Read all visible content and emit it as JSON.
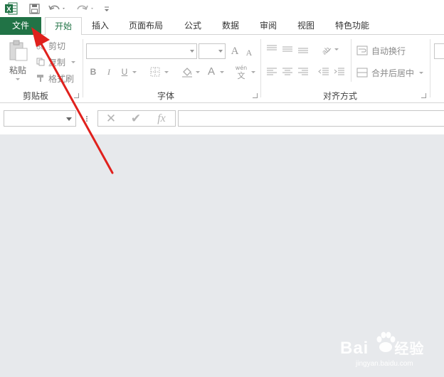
{
  "tabs": {
    "file": "文件",
    "home": "开始",
    "insert": "插入",
    "page_layout": "页面布局",
    "formulas": "公式",
    "data": "数据",
    "review": "审阅",
    "view": "视图",
    "special": "特色功能"
  },
  "clipboard": {
    "paste": "粘贴",
    "cut": "剪切",
    "copy": "复制",
    "format_painter": "格式刷",
    "group_label": "剪贴板"
  },
  "font": {
    "group_label": "字体",
    "bold": "B",
    "italic": "I",
    "underline": "U",
    "font_color": "A",
    "grow": "A",
    "shrink": "A",
    "phonetic_top": "wén",
    "phonetic_bottom": "文"
  },
  "alignment": {
    "group_label": "对齐方式",
    "wrap_text": "自动换行",
    "merge_center": "合并后居中"
  },
  "formula_bar": {
    "cancel": "✕",
    "enter": "✔",
    "fx": "fx"
  },
  "watermark": {
    "brand": "Bai",
    "brand2": "经验",
    "url": "jingyan.baidu.com"
  },
  "colors": {
    "excel_green": "#217346",
    "arrow_red": "#e0211d",
    "canvas": "#e7e9ec"
  }
}
